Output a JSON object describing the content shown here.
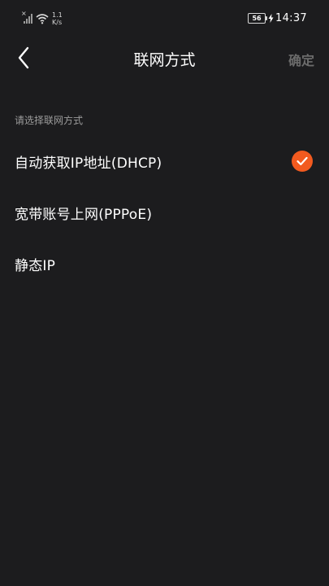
{
  "status_bar": {
    "net_speed_value": "1.1",
    "net_speed_unit": "K/s",
    "battery_level": "56",
    "time": "14:37"
  },
  "nav": {
    "title": "联网方式",
    "confirm_label": "确定"
  },
  "section": {
    "label": "请选择联网方式"
  },
  "options": [
    {
      "label": "自动获取IP地址(DHCP)",
      "selected": true
    },
    {
      "label": "宽带账号上网(PPPoE)",
      "selected": false
    },
    {
      "label": "静态IP",
      "selected": false
    }
  ],
  "colors": {
    "background": "#1c1c1e",
    "accent": "#f25a1f",
    "confirm_disabled": "#6b6b6b",
    "secondary_text": "#9c9c9c"
  }
}
